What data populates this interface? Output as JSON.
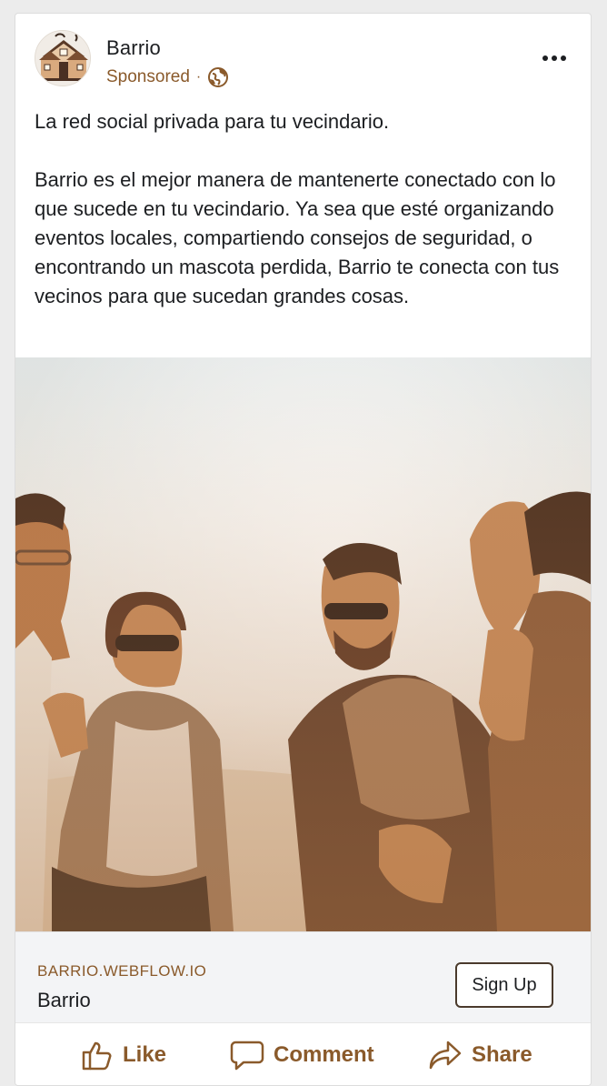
{
  "page": {
    "name": "Barrio",
    "sponsored_label": "Sponsored",
    "separator": "·",
    "avatar_icon": "house-logo-icon",
    "audience_icon": "globe-icon",
    "more_icon": "more-options-icon"
  },
  "post": {
    "headline": "La red social privada para tu vecindario.",
    "body": "Barrio es el mejor manera de mantenerte conectado con lo que sucede en tu vecindario. Ya sea que esté organizando eventos locales, compartiendo consejos de seguridad, o encontrando un mascota perdida, Barrio te conecta con tus vecinos para que sucedan grandes cosas."
  },
  "link_preview": {
    "domain": "BARRIO.WEBFLOW.IO",
    "title": "Barrio",
    "cta_label": "Sign Up"
  },
  "actions": {
    "like_label": "Like",
    "comment_label": "Comment",
    "share_label": "Share"
  },
  "colors": {
    "accent": "#8a5a2b",
    "text": "#1c1e21",
    "link_bar_bg": "#f3f4f6"
  }
}
